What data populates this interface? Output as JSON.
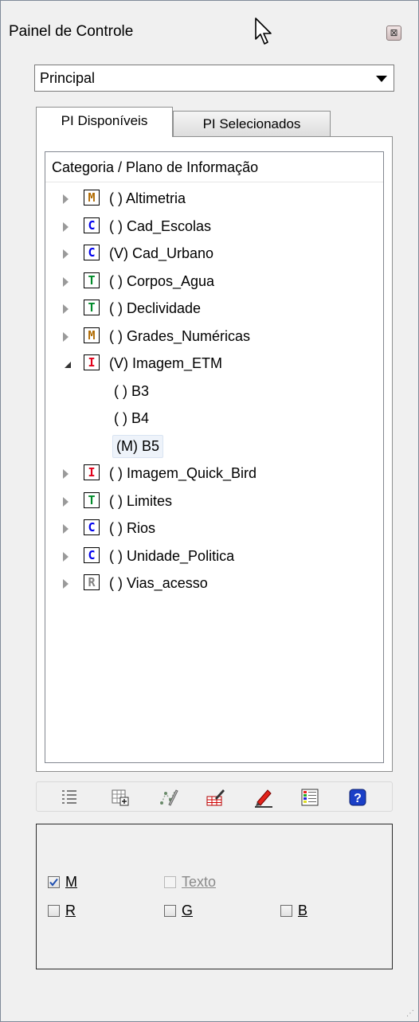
{
  "window": {
    "title": "Painel de Controle",
    "close_label": "⊠"
  },
  "dropdown": {
    "value": "Principal"
  },
  "tabs": [
    {
      "label": "PI Disponíveis",
      "active": true
    },
    {
      "label": "PI Selecionados",
      "active": false
    }
  ],
  "tree": {
    "header": "Categoria / Plano de Informação",
    "items": [
      {
        "badge": "M",
        "badge_color": "#b06a00",
        "label": "( ) Altimetria",
        "expanded": false
      },
      {
        "badge": "C",
        "badge_color": "#0000ee",
        "label": "( ) Cad_Escolas",
        "expanded": false
      },
      {
        "badge": "C",
        "badge_color": "#0000ee",
        "label": "(V) Cad_Urbano",
        "expanded": false
      },
      {
        "badge": "T",
        "badge_color": "#008a2a",
        "label": "( ) Corpos_Agua",
        "expanded": false
      },
      {
        "badge": "T",
        "badge_color": "#008a2a",
        "label": "( ) Declividade",
        "expanded": false
      },
      {
        "badge": "M",
        "badge_color": "#b06a00",
        "label": "( ) Grades_Numéricas",
        "expanded": false
      },
      {
        "badge": "I",
        "badge_color": "#e0001a",
        "label": "(V) Imagem_ETM",
        "expanded": true,
        "children": [
          {
            "label": "( ) B3"
          },
          {
            "label": "( ) B4"
          },
          {
            "label": "(M) B5",
            "selected": true
          }
        ]
      },
      {
        "badge": "I",
        "badge_color": "#e0001a",
        "label": "( ) Imagem_Quick_Bird",
        "expanded": false
      },
      {
        "badge": "T",
        "badge_color": "#008a2a",
        "label": "( ) Limites",
        "expanded": false
      },
      {
        "badge": "C",
        "badge_color": "#0000ee",
        "label": "( ) Rios",
        "expanded": false
      },
      {
        "badge": "C",
        "badge_color": "#0000ee",
        "label": "( ) Unidade_Politica",
        "expanded": false
      },
      {
        "badge": "R",
        "badge_color": "#808080",
        "label": "( ) Vias_acesso",
        "expanded": false
      }
    ]
  },
  "toolbar": {
    "buttons": [
      {
        "icon": "list-icon"
      },
      {
        "icon": "add-table-icon"
      },
      {
        "icon": "edit-points-icon"
      },
      {
        "icon": "paint-table-icon"
      },
      {
        "icon": "pencil-icon"
      },
      {
        "icon": "legend-table-icon"
      },
      {
        "icon": "help-icon"
      }
    ]
  },
  "options": {
    "m": {
      "label": "M",
      "checked": true
    },
    "texto": {
      "label": "Texto",
      "checked": false,
      "disabled": true
    },
    "r": {
      "label": "R",
      "checked": false
    },
    "g": {
      "label": "G",
      "checked": false
    },
    "b": {
      "label": "B",
      "checked": false
    }
  }
}
